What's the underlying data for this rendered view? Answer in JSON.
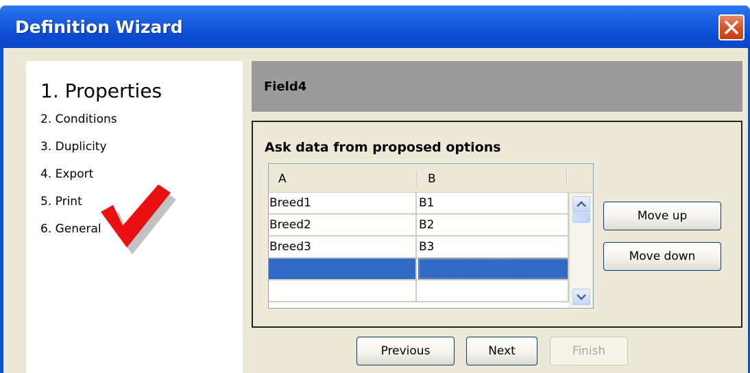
{
  "window": {
    "title": "Definition Wizard"
  },
  "steps": {
    "current": "1. Properties",
    "items": [
      "2. Conditions",
      "3. Duplicity",
      "4. Export",
      "5. Print",
      "6. General"
    ]
  },
  "header": {
    "title": "Field4"
  },
  "group": {
    "title": "Ask data from proposed options"
  },
  "table": {
    "columns": [
      "A",
      "B"
    ],
    "rows": [
      [
        "Breed1",
        "B1"
      ],
      [
        "Breed2",
        "B2"
      ],
      [
        "Breed3",
        "B3"
      ],
      [
        "",
        ""
      ],
      [
        "",
        ""
      ]
    ],
    "selected_row": 3
  },
  "buttons": {
    "move_up": "Move up",
    "move_down": "Move down",
    "previous": "Previous",
    "next": "Next",
    "finish": "Finish"
  },
  "colors": {
    "titlebar": "#0a4fd8",
    "selection": "#316ac5",
    "checkmark": "#e81010"
  },
  "icons": [
    "close-icon",
    "checkmark-icon",
    "scroll-up-icon",
    "scroll-down-icon"
  ]
}
